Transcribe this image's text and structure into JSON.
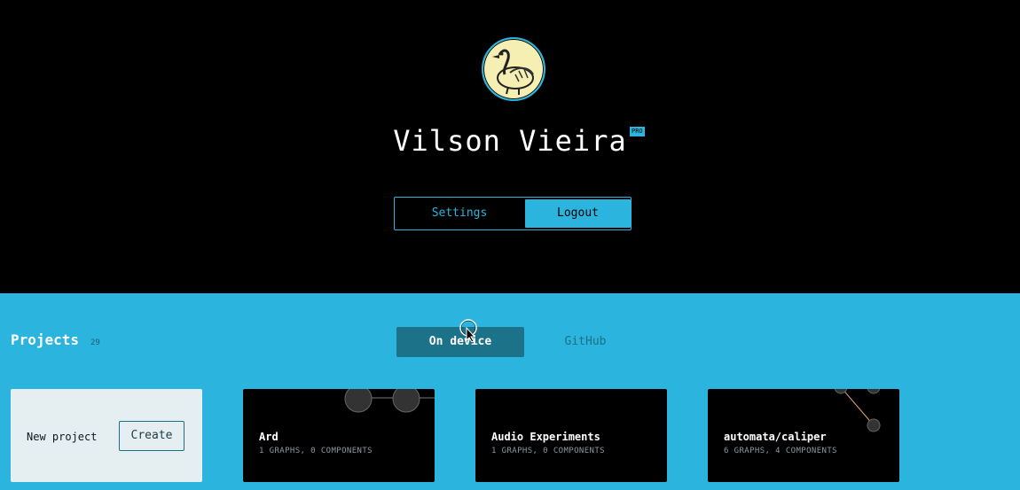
{
  "profile": {
    "name": "Vilson Vieira",
    "badge": "PRO",
    "avatar_icon": "bird-avatar-icon"
  },
  "account_buttons": {
    "settings_label": "Settings",
    "logout_label": "Logout"
  },
  "projects": {
    "title": "Projects",
    "count": "29",
    "tabs": [
      {
        "label": "On device",
        "active": true
      },
      {
        "label": "GitHub",
        "active": false
      }
    ],
    "new_card": {
      "label": "New project",
      "create_label": "Create"
    },
    "cards": [
      {
        "title": "Ard",
        "subtitle": "1 GRAPHS, 0 COMPONENTS"
      },
      {
        "title": "Audio Experiments",
        "subtitle": "1 GRAPHS, 0 COMPONENTS"
      },
      {
        "title": "automata/caliper",
        "subtitle": "6 GRAPHS, 4 COMPONENTS"
      }
    ]
  },
  "colors": {
    "accent": "#2bb4dd",
    "active_tab": "#1c7289",
    "background_top": "#000000"
  }
}
